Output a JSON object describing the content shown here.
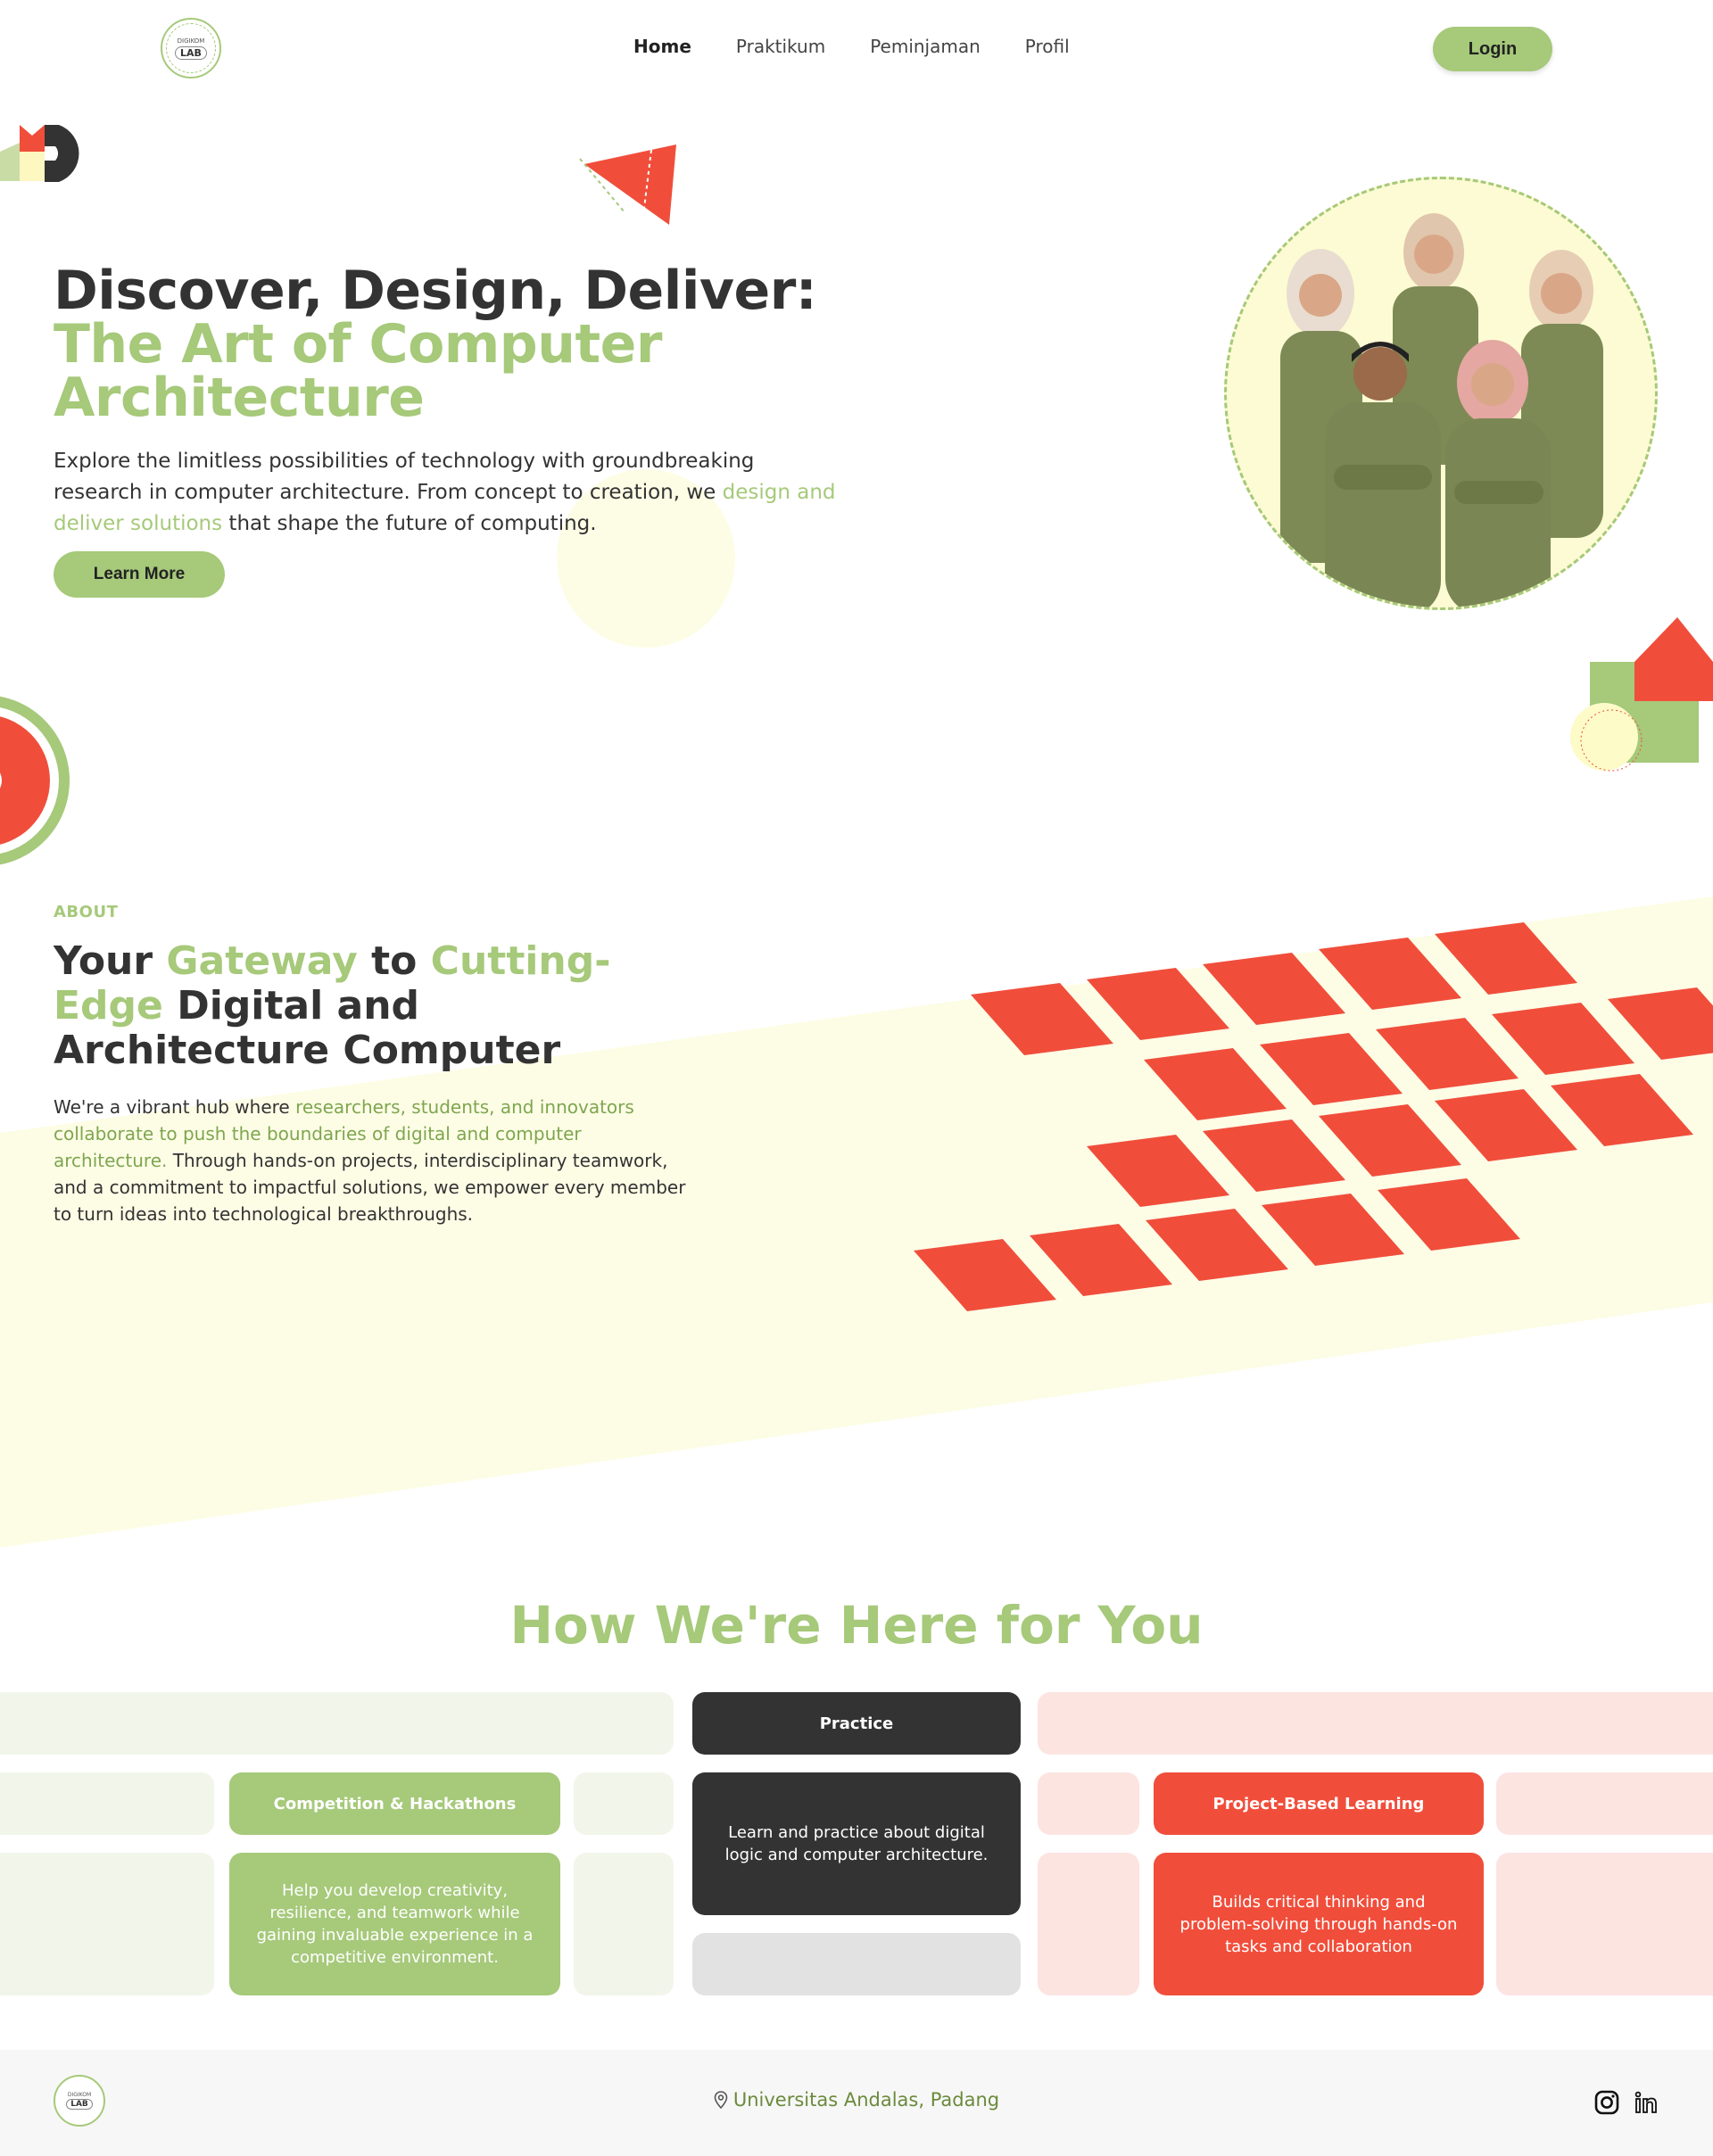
{
  "nav": {
    "logo": {
      "top": "DIGIKOM",
      "bottom": "LAB"
    },
    "items": [
      {
        "label": "Home",
        "active": true
      },
      {
        "label": "Praktikum",
        "active": false
      },
      {
        "label": "Peminjaman",
        "active": false
      },
      {
        "label": "Profil",
        "active": false
      }
    ],
    "login_label": "Login"
  },
  "hero": {
    "title_line1": "Discover, Design, Deliver:",
    "title_line2": "The Art of Computer",
    "title_line3": "Architecture",
    "text_part1": "Explore the limitless possibilities of technology with groundbreaking research in computer architecture. From concept to creation, we ",
    "text_highlight": "design and deliver solutions",
    "text_part2": " that shape the future of computing.",
    "button_label": "Learn More"
  },
  "about": {
    "label": "ABOUT",
    "title_w1": "Your ",
    "title_w2": "Gateway",
    "title_w3": " to ",
    "title_w4": "Cutting-Edge",
    "title_w5": " Digital and Architecture Computer",
    "text_part1": "We're a vibrant hub where ",
    "text_highlight": "researchers, students, and innovators collaborate to push the boundaries of digital and computer architecture.",
    "text_part2": " Through hands-on projects, interdisciplinary teamwork, and a commitment to impactful solutions, we empower every member to turn ideas into technological breakthroughs."
  },
  "services": {
    "title": "How We're Here for You",
    "cards": [
      {
        "title": "Competition & Hackathons",
        "desc": "Help you develop creativity, resilience, and teamwork while gaining invaluable experience in a competitive environment."
      },
      {
        "title": "Practice",
        "desc": "Learn and practice about digital logic and computer architecture."
      },
      {
        "title": "Project-Based Learning",
        "desc": "Builds critical thinking and problem-solving through hands-on tasks and collaboration"
      }
    ]
  },
  "footer": {
    "logo": {
      "top": "DIGIKOM",
      "bottom": "LAB"
    },
    "location": "Universitas Andalas, Padang",
    "social": [
      "instagram-icon",
      "linkedin-icon"
    ]
  },
  "colors": {
    "green": "#a6c97a",
    "red": "#f04e3b",
    "dark": "#333333",
    "cream": "#fdfde6"
  }
}
